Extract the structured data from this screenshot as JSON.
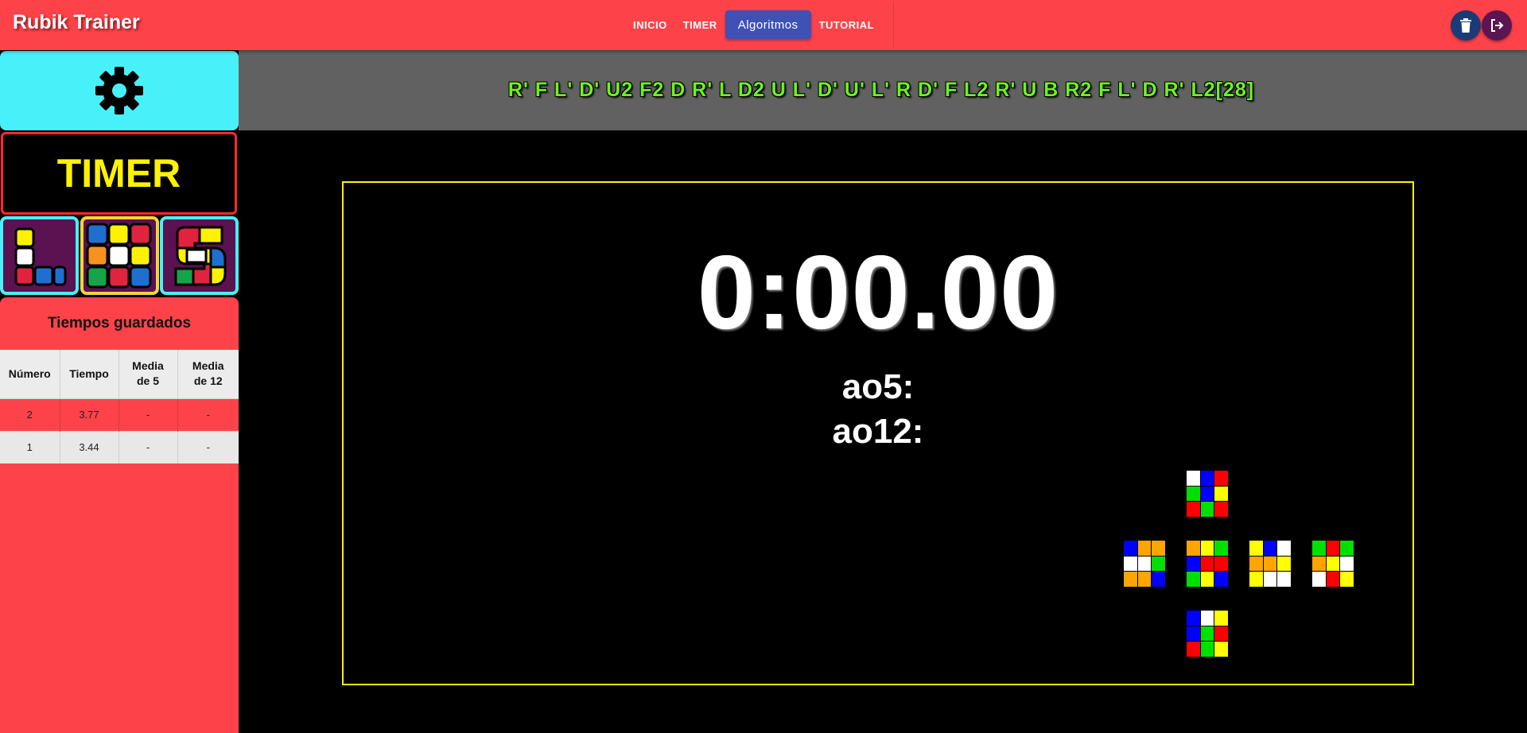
{
  "app": {
    "title": "Rubik Trainer"
  },
  "nav": {
    "items": [
      {
        "label": "INICIO",
        "active": false
      },
      {
        "label": "TIMER",
        "active": false
      },
      {
        "label": "Algoritmos",
        "active": true
      },
      {
        "label": "TUTORIAL",
        "active": false
      }
    ]
  },
  "header_actions": {
    "delete_icon": "trash-icon",
    "logout_icon": "logout-icon"
  },
  "sidebar": {
    "settings_icon": "gear-icon",
    "timer_label": "TIMER",
    "modes": [
      {
        "icon": "L-cube-icon",
        "selected": false
      },
      {
        "icon": "3x3-cube-icon",
        "selected": true
      },
      {
        "icon": "S-cube-icon",
        "selected": false
      }
    ]
  },
  "times": {
    "title": "Tiempos guardados",
    "headers": [
      "Número",
      "Tiempo",
      "Media de 5",
      "Media de 12"
    ],
    "rows": [
      [
        "2",
        "3.77",
        "-",
        "-"
      ],
      [
        "1",
        "3.44",
        "-",
        "-"
      ]
    ]
  },
  "scramble": {
    "text": "R' F L' D' U2 F2 D R' L D2 U L' D' U' L' R D' F L2 R' U B R2 F L' D R' L2[28]"
  },
  "timer": {
    "display": "0:00.00",
    "ao5_label": "ao5:",
    "ao12_label": "ao12:"
  },
  "cube_net": {
    "colors": {
      "W": "#ffffff",
      "B": "#0000ff",
      "R": "#ff0000",
      "G": "#00e000",
      "Y": "#ffff00",
      "O": "#ffa500"
    },
    "faces": {
      "up": [
        "W",
        "B",
        "R",
        "G",
        "B",
        "Y",
        "R",
        "G",
        "R"
      ],
      "left": [
        "B",
        "O",
        "O",
        "W",
        "W",
        "G",
        "O",
        "O",
        "B"
      ],
      "front": [
        "O",
        "Y",
        "G",
        "B",
        "R",
        "R",
        "G",
        "Y",
        "B"
      ],
      "right": [
        "Y",
        "B",
        "W",
        "O",
        "O",
        "Y",
        "Y",
        "W",
        "W"
      ],
      "back": [
        "G",
        "R",
        "G",
        "O",
        "Y",
        "W",
        "W",
        "R",
        "Y"
      ],
      "down": [
        "B",
        "W",
        "Y",
        "B",
        "G",
        "R",
        "R",
        "G",
        "Y"
      ]
    }
  },
  "colors": {
    "accent_red": "#fe4249",
    "accent_cyan": "#48f1f9",
    "nav_active": "#3f51b5",
    "timer_yellow": "#fff200",
    "scramble_green": "#6df21f"
  }
}
